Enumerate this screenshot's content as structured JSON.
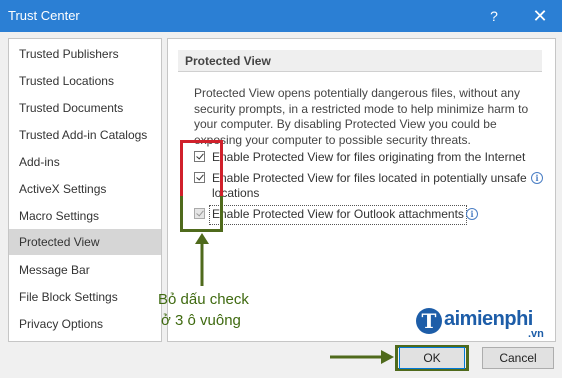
{
  "window": {
    "title": "Trust Center",
    "help_glyph": "?",
    "close_glyph": "✕"
  },
  "sidebar": {
    "items": [
      {
        "label": "Trusted Publishers",
        "selected": false
      },
      {
        "label": "Trusted Locations",
        "selected": false
      },
      {
        "label": "Trusted Documents",
        "selected": false
      },
      {
        "label": "Trusted Add-in Catalogs",
        "selected": false
      },
      {
        "label": "Add-ins",
        "selected": false
      },
      {
        "label": "ActiveX Settings",
        "selected": false
      },
      {
        "label": "Macro Settings",
        "selected": false
      },
      {
        "label": "Protected View",
        "selected": true
      },
      {
        "label": "Message Bar",
        "selected": false
      },
      {
        "label": "File Block Settings",
        "selected": false
      },
      {
        "label": "Privacy Options",
        "selected": false
      }
    ]
  },
  "main": {
    "section_title": "Protected View",
    "description": "Protected View opens potentially dangerous files, without any security prompts, in a restricted mode to help minimize harm to your computer. By disabling Protected View you could be exposing your computer to possible security threats.",
    "options": [
      {
        "label": "Enable Protected View for files originating from the Internet",
        "checked": true,
        "disabled": false,
        "info": false
      },
      {
        "label": "Enable Protected View for files located in potentially unsafe locations",
        "checked": true,
        "disabled": false,
        "info": true
      },
      {
        "label": "Enable Protected View for Outlook attachments",
        "checked": true,
        "disabled": true,
        "info": true
      }
    ],
    "info_glyph": "i"
  },
  "annotation": {
    "line1": "Bỏ dấu check",
    "line2": "ở 3 ô vuông",
    "color": "#3f6a10"
  },
  "buttons": {
    "ok": "OK",
    "cancel": "Cancel"
  },
  "watermark": {
    "mark": "T",
    "name": "aimienphi",
    "suffix": ".vn"
  }
}
